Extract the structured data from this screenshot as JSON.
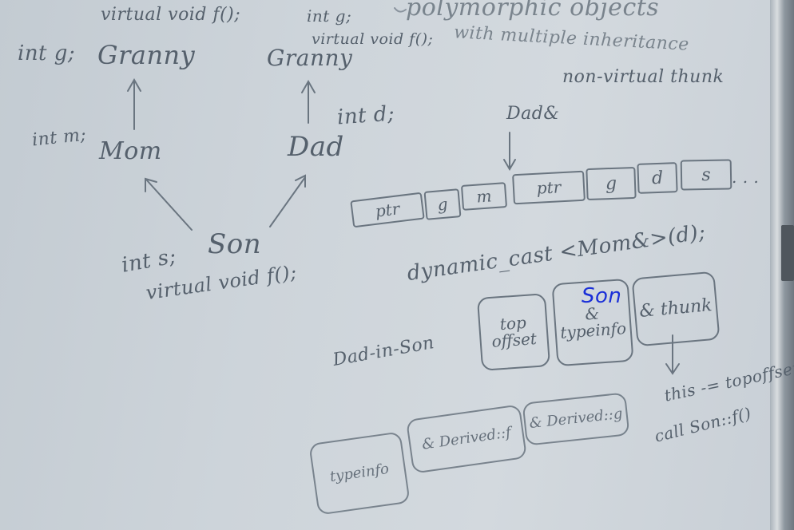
{
  "board": {
    "title_line1": "polymorphic objects",
    "title_line2": "with multiple inheritance",
    "granny_left": {
      "decl": "virtual void f();",
      "member": "int g;",
      "name": "Granny"
    },
    "granny_right": {
      "member": "int g;",
      "decl": "virtual void f();",
      "name": "Granny"
    },
    "mom": {
      "member": "int m;",
      "name": "Mom"
    },
    "dad": {
      "member": "int d;",
      "name": "Dad"
    },
    "son": {
      "member": "int s;",
      "name": "Son",
      "decl": "virtual void f();"
    },
    "non_virtual_thunk": "non-virtual thunk",
    "dad_ref": "Dad&",
    "layout_cells": [
      "ptr",
      "g",
      "m",
      "ptr",
      "g",
      "d",
      "s"
    ],
    "layout_ellipsis": ". . .",
    "dynamic_cast": "dynamic_cast <Mom&>(d);",
    "dad_in_son": "Dad-in-Son",
    "vtable_cells": [
      "top offset",
      "& typeinfo",
      "& thunk"
    ],
    "thunk_note_line1": "this -= topoffset",
    "thunk_note_line2": "call Son::f()",
    "derived_cells": [
      "typeinfo",
      "& Derived::f",
      "& Derived::g"
    ],
    "blue_annotation": "Son"
  }
}
